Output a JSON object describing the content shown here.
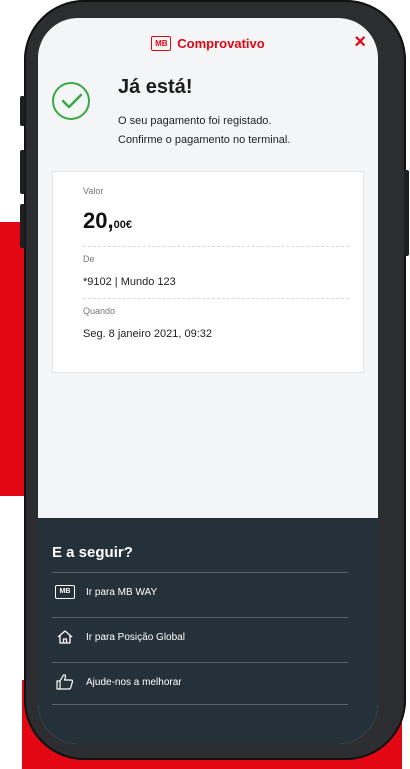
{
  "header": {
    "logo_text": "MB",
    "title": "Comprovativo",
    "close": "×"
  },
  "success": {
    "title": "Já está!",
    "line1": "O seu pagamento foi registado.",
    "line2": "Confirme o pagamento no terminal."
  },
  "details": {
    "valor_label": "Valor",
    "valor_int": "20,",
    "valor_dec": "00€",
    "de_label": "De",
    "de_value": "*9102 | Mundo 123",
    "quando_label": "Quando",
    "quando_value": "Seg. 8 janeiro 2021, 09:32"
  },
  "next": {
    "title": "E a seguir?",
    "items": [
      {
        "label": "Ir para MB WAY",
        "icon": "mb-logo-icon",
        "logo_text": "MB"
      },
      {
        "label": "Ir para Posição Global",
        "icon": "home-icon"
      },
      {
        "label": "Ajude-nos a melhorar",
        "icon": "thumbs-up-icon"
      }
    ]
  },
  "colors": {
    "brand_red": "#e30613",
    "success_green": "#39a843",
    "dark_panel": "#253139"
  }
}
